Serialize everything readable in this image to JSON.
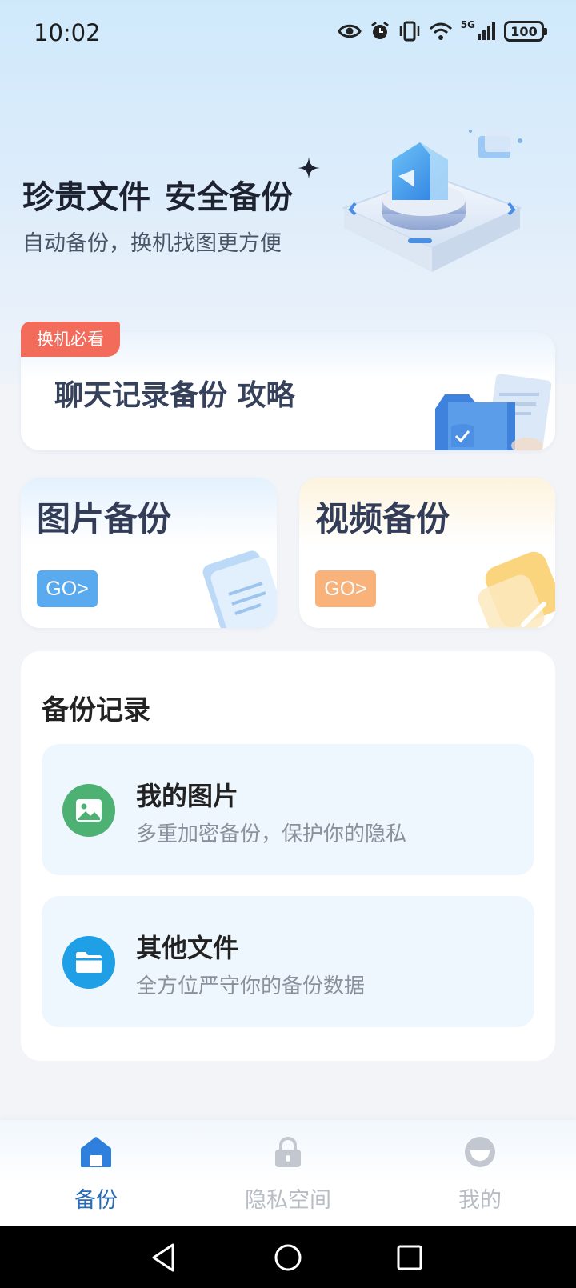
{
  "status_bar": {
    "time": "10:02",
    "network": "5G",
    "battery": "100"
  },
  "hero": {
    "title_main": "珍贵文件",
    "title_highlight": "安全备份",
    "subtitle": "自动备份，换机找图更方便"
  },
  "guide": {
    "badge": "换机必看",
    "text": "聊天记录备份 攻略"
  },
  "features": [
    {
      "title": "图片备份",
      "go_label": "GO>"
    },
    {
      "title": "视频备份",
      "go_label": "GO>"
    }
  ],
  "records": {
    "title": "备份记录",
    "items": [
      {
        "title": "我的图片",
        "desc": "多重加密备份，保护你的隐私",
        "icon": "image-icon"
      },
      {
        "title": "其他文件",
        "desc": "全方位严守你的备份数据",
        "icon": "folder-icon"
      }
    ]
  },
  "bottom_nav": {
    "items": [
      {
        "label": "备份",
        "icon": "home-icon",
        "active": true
      },
      {
        "label": "隐私空间",
        "icon": "lock-icon",
        "active": false
      },
      {
        "label": "我的",
        "icon": "profile-icon",
        "active": false
      }
    ]
  },
  "colors": {
    "accent_blue": "#2a6bb5",
    "badge_red": "#f26b5b",
    "go_blue": "#5aaaf0",
    "go_orange": "#f8b27a",
    "photo_icon_green": "#4db174",
    "folder_icon_blue": "#1f9fe6"
  }
}
